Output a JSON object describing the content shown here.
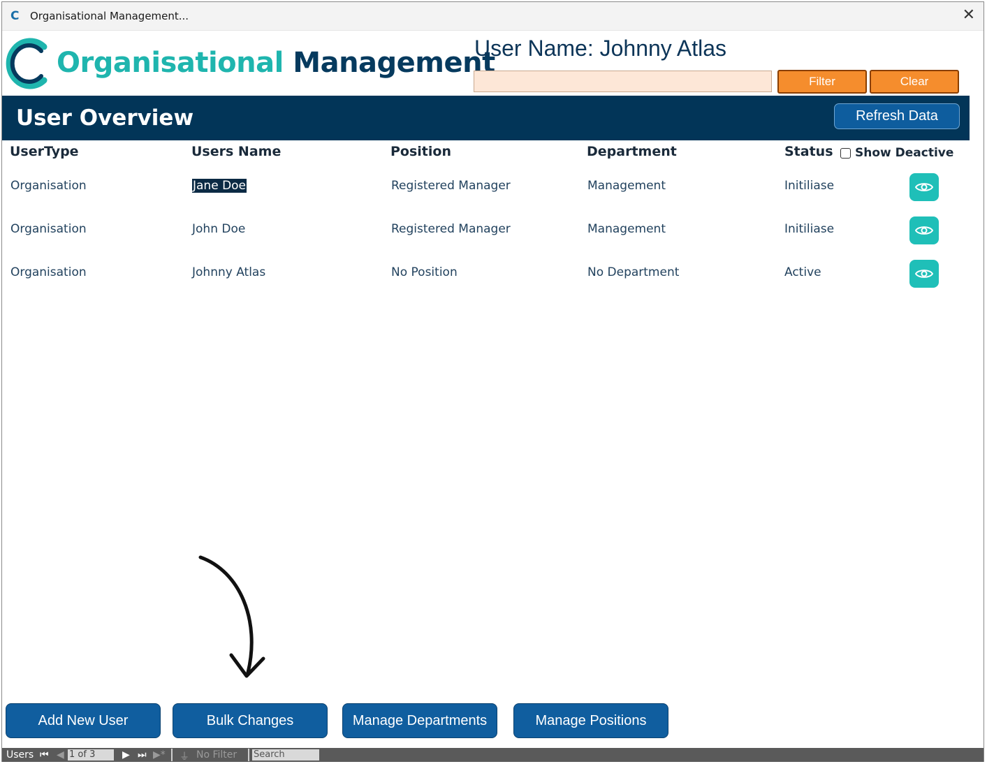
{
  "window": {
    "title": "Organisational Management...",
    "close_glyph": "✕"
  },
  "header": {
    "logo_word1": "Organisational",
    "logo_word2": "Management",
    "user_name": "User Name: Johnny Atlas",
    "filter_value": "",
    "filter_label": "Filter",
    "clear_label": "Clear"
  },
  "banner": {
    "heading": "User Overview",
    "refresh_label": "Refresh Data"
  },
  "table": {
    "columns": [
      "UserType",
      "Users Name",
      "Position",
      "Department",
      "Status"
    ],
    "show_deactive_label": "Show Deactive",
    "show_deactive_checked": false,
    "rows": [
      {
        "usertype": "Organisation",
        "name": "Jane Doe",
        "position": "Registered Manager",
        "department": "Management",
        "status": "Initiliase",
        "selected": true
      },
      {
        "usertype": "Organisation",
        "name": "John Doe",
        "position": "Registered Manager",
        "department": "Management",
        "status": "Initiliase",
        "selected": false
      },
      {
        "usertype": "Organisation",
        "name": "Johnny Atlas",
        "position": "No Position",
        "department": "No Department",
        "status": "Active",
        "selected": false
      }
    ]
  },
  "actions": {
    "add_user": "Add New User",
    "bulk_changes": "Bulk Changes",
    "manage_departments": "Manage Departments",
    "manage_positions": "Manage Positions"
  },
  "navbar": {
    "label": "Users",
    "record": "1 of 3",
    "filter_status": "No Filter",
    "search_placeholder": "Search"
  },
  "colors": {
    "banner": "#023558",
    "teal": "#1fb5ae",
    "orange": "#f58d2d",
    "button_blue": "#105e9f",
    "filter_field": "#fde7d7"
  }
}
